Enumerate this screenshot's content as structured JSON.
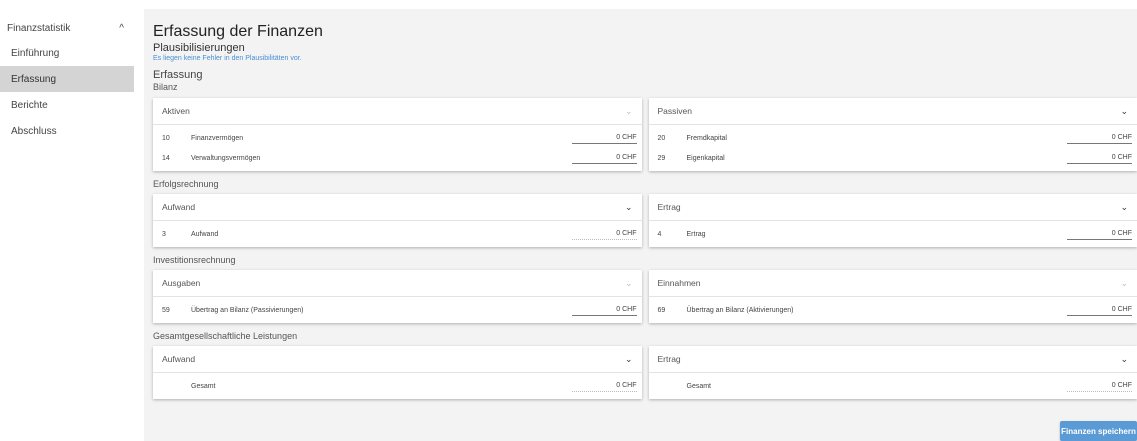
{
  "sidebar": {
    "header": "Finanzstatistik",
    "items": [
      {
        "label": "Einführung"
      },
      {
        "label": "Erfassung"
      },
      {
        "label": "Berichte"
      },
      {
        "label": "Abschluss"
      }
    ]
  },
  "page": {
    "title": "Erfassung der Finanzen",
    "subtitle": "Plausibilisierungen",
    "info": "Es liegen keine Fehler in den Plausibilitäten vor.",
    "section": "Erfassung",
    "section_sub": "Bilanz"
  },
  "groups": {
    "erfolgsrechnung": "Erfolgsrechnung",
    "investitionsrechnung": "Investitionsrechnung",
    "gesamt": "Gesamtgesellschaftliche Leistungen"
  },
  "cards": {
    "aktiven": {
      "title": "Aktiven",
      "rows": [
        {
          "num": "10",
          "label": "Finanzvermögen",
          "value": "0 CHF"
        },
        {
          "num": "14",
          "label": "Verwaltungsvermögen",
          "value": "0 CHF"
        }
      ]
    },
    "passiven": {
      "title": "Passiven",
      "rows": [
        {
          "num": "20",
          "label": "Fremdkapital",
          "value": "0 CHF"
        },
        {
          "num": "29",
          "label": "Eigenkapital",
          "value": "0 CHF"
        }
      ]
    },
    "aufwand": {
      "title": "Aufwand",
      "rows": [
        {
          "num": "3",
          "label": "Aufwand",
          "value": "0 CHF"
        }
      ]
    },
    "ertrag": {
      "title": "Ertrag",
      "rows": [
        {
          "num": "4",
          "label": "Ertrag",
          "value": "0 CHF"
        }
      ]
    },
    "ausgaben": {
      "title": "Ausgaben",
      "rows": [
        {
          "num": "59",
          "label": "Übertrag an Bilanz (Passivierungen)",
          "value": "0 CHF"
        }
      ]
    },
    "einnahmen": {
      "title": "Einnahmen",
      "rows": [
        {
          "num": "69",
          "label": "Übertrag an Bilanz (Aktivierungen)",
          "value": "0 CHF"
        }
      ]
    },
    "gl_aufwand": {
      "title": "Aufwand",
      "rows": [
        {
          "label": "Gesamt",
          "value": "0 CHF"
        }
      ]
    },
    "gl_ertrag": {
      "title": "Ertrag",
      "rows": [
        {
          "label": "Gesamt",
          "value": "0 CHF"
        }
      ]
    }
  },
  "icons": {
    "chevron_up": "^",
    "chevron_down": "⌄"
  },
  "buttons": {
    "save": "Finanzen speichern"
  },
  "colors": {
    "accent": "#5b9bd5",
    "info_text": "#4a8fd6",
    "active_nav": "#d4d4d4"
  }
}
